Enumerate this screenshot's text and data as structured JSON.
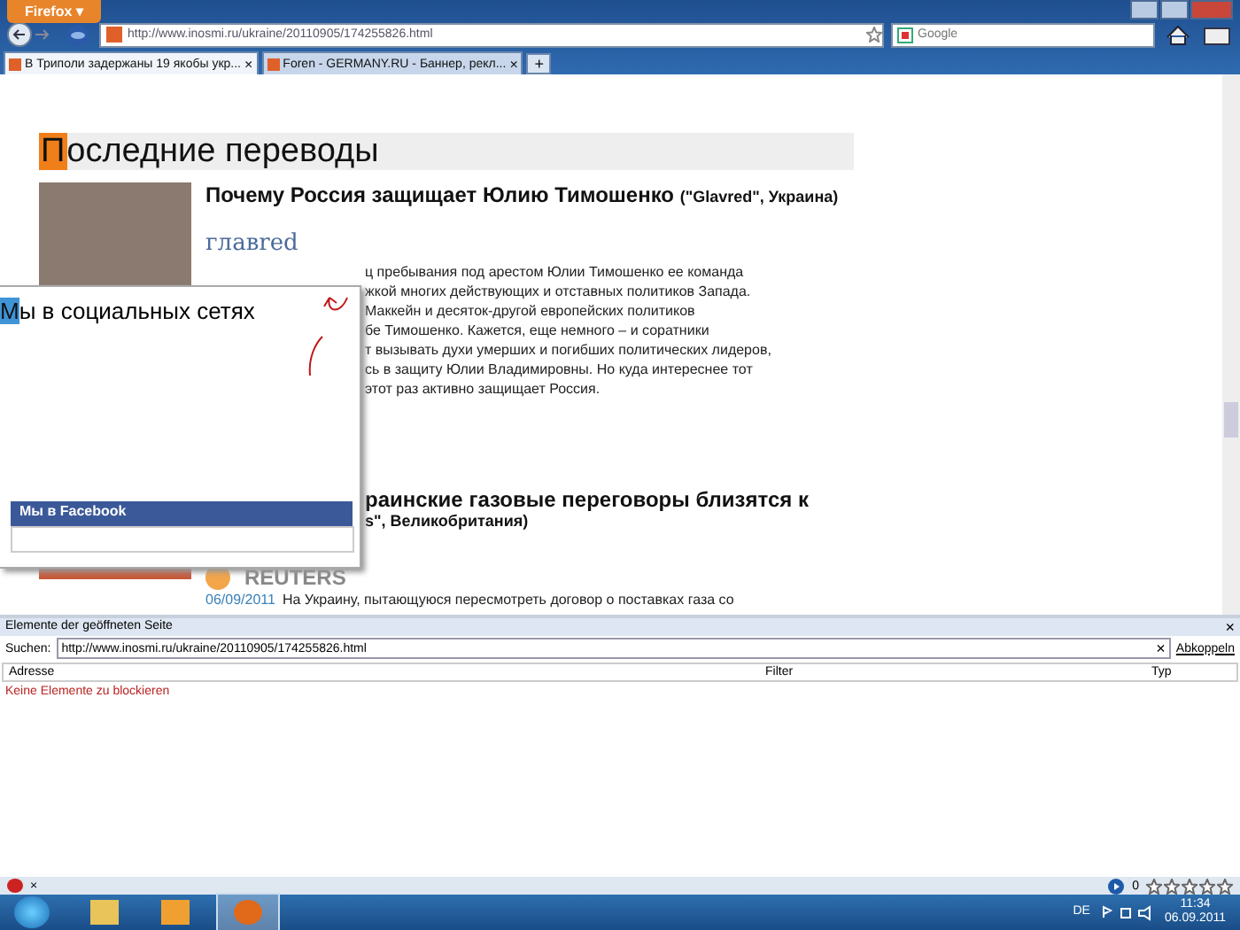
{
  "browser": {
    "menu_button": "Firefox ▾",
    "address": "http://www.inosmi.ru/ukraine/20110905/174255826.html",
    "search": {
      "placeholder": "Google"
    }
  },
  "tabs": [
    {
      "label": "В Триполи задержаны 19 якобы укр...",
      "selected": true,
      "close": "×"
    },
    {
      "label": "Foren - GERMANY.RU - Баннер, рекл...",
      "selected": false,
      "close": "×"
    }
  ],
  "new_tab": "+",
  "page": {
    "heading_first": "П",
    "heading_rest": "оследние переводы",
    "articles": [
      {
        "title": "Почему Россия защищает Юлию Тимошенко",
        "source": "(\"Glavred\", Украина)",
        "logo": "главred",
        "lines": [
          "ц пребывания под арестом Юлии Тимошенко ее команда",
          "жкой многих действующих и отставных политиков Запада.",
          "Маккейн и десяток-другой европейских политиков",
          "бе Тимошенко. Кажется, еще немного – и соратники",
          "т вызывать духи умерших и погибших политических лидеров,",
          "сь в защиту Юлии Владимировны. Но куда интереснее тот",
          "этот раз активно защищает Россия."
        ]
      },
      {
        "title": "раинские газовые переговоры близятся к",
        "source": "s\", Великобритания)",
        "logo": "REUTERS",
        "date": "06/09/2011",
        "lines": [
          "На Украину, пытающуюся пересмотреть договор о поставках газа со"
        ]
      }
    ]
  },
  "popup": {
    "title_first": "М",
    "title_rest": "ы в социальных сетях",
    "facebook": "Мы в Facebook"
  },
  "panel": {
    "title": "Elemente der geöffneten Seite",
    "close": "×",
    "search_label": "Suchen:",
    "search_value": "http://www.inosmi.ru/ukraine/20110905/174255826.html",
    "clear": "×",
    "detach": "Abkoppeln",
    "columns": [
      "Adresse",
      "Filter",
      "Typ"
    ],
    "empty": "Keine Elemente zu blockieren"
  },
  "status_bar": {
    "close": "×",
    "count": "0",
    "stars": 0
  },
  "taskbar": {
    "language": "DE",
    "time": "11:34",
    "date": "06.09.2011",
    "apps": [
      {
        "kind": "folder",
        "selected": false
      },
      {
        "kind": "media",
        "selected": false
      },
      {
        "kind": "firefox",
        "selected": true
      }
    ]
  }
}
